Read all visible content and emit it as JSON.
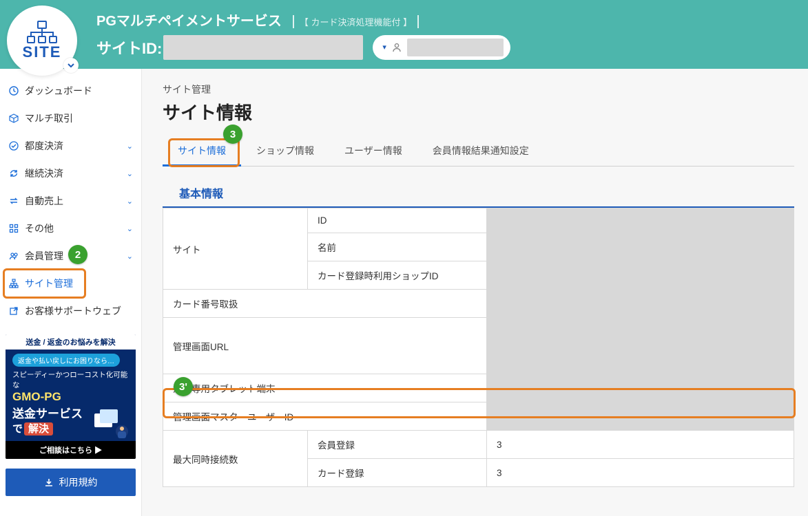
{
  "header": {
    "service_name": "PGマルチペイメントサービス",
    "service_sub": "【 カード決済処理機能付 】",
    "site_id_label": "サイトID:",
    "logo_text": "SITE"
  },
  "sidebar": {
    "items": [
      {
        "label": "ダッシュボード",
        "expandable": false
      },
      {
        "label": "マルチ取引",
        "expandable": false
      },
      {
        "label": "都度決済",
        "expandable": true
      },
      {
        "label": "継続決済",
        "expandable": true
      },
      {
        "label": "自動売上",
        "expandable": true
      },
      {
        "label": "その他",
        "expandable": true
      },
      {
        "label": "会員管理",
        "expandable": true
      },
      {
        "label": "サイト管理",
        "expandable": false,
        "active": true
      },
      {
        "label": "お客様サポートウェブ",
        "expandable": false
      }
    ],
    "promo": {
      "top": "送金 / 返金のお悩みを解決",
      "pill": "返金や払い戻しにお困りなら…",
      "line1": "スピーディーかつローコスト化可能な",
      "brand": "GMO-PG",
      "svc": "送金サービス",
      "solve_pre": "で",
      "solve": "解決",
      "cta": "ご相談はこちら ▶"
    },
    "terms_btn": "利用規約"
  },
  "main": {
    "breadcrumb": "サイト管理",
    "title": "サイト情報",
    "tabs": [
      {
        "label": "サイト情報",
        "active": true
      },
      {
        "label": "ショップ情報"
      },
      {
        "label": "ユーザー情報"
      },
      {
        "label": "会員情報結果通知設定"
      }
    ],
    "section_title": "基本情報",
    "rows": {
      "site": "サイト",
      "site_id": "ID",
      "site_name": "名前",
      "site_shop_id": "カード登録時利用ショップID",
      "card_handling": "カード番号取扱",
      "admin_url": "管理画面URL",
      "tablet": "決済専用タブレット端末",
      "master_user": "管理画面マスターユーザーID",
      "max_conn": "最大同時接続数",
      "max_conn_member": "会員登録",
      "max_conn_member_val": "3",
      "max_conn_card": "カード登録",
      "max_conn_card_val": "3"
    }
  },
  "markers": {
    "m2": "2",
    "m3": "3",
    "m3p": "3'"
  }
}
